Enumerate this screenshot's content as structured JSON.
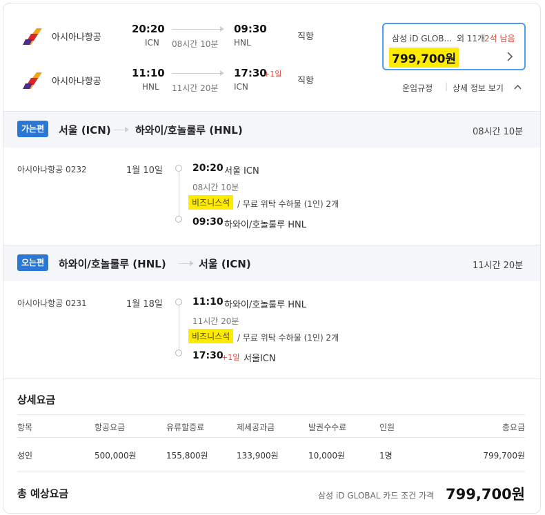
{
  "summary": {
    "outbound": {
      "airline": "아시아나항공",
      "dep_time": "20:20",
      "dep_code": "ICN",
      "duration": "08시간 10분",
      "arr_time": "09:30",
      "arr_code": "HNL",
      "arr_plus": "",
      "type": "직항"
    },
    "inbound": {
      "airline": "아시아나항공",
      "dep_time": "11:10",
      "dep_code": "HNL",
      "duration": "11시간 20분",
      "arr_time": "17:30",
      "arr_code": "ICN",
      "arr_plus": "+1일",
      "type": "직항"
    },
    "price_box": {
      "card_label": "삼성 iD GLOB...",
      "seats_prefix": "외 11개",
      "seats_left": "2석 남음",
      "price": "799,700원"
    },
    "fare_rules_link": "운임규정",
    "separator": "|",
    "details_link": "상세 정보 보기",
    "colors": {
      "accent_blue": "#2b77d6",
      "highlight": "#ffeb00",
      "red": "#e2483a",
      "box_border": "#4a9cf5"
    }
  },
  "outbound_section": {
    "badge": "가는편",
    "from": "서울 (ICN)",
    "to": "하와이/호놀룰루 (HNL)",
    "duration": "08시간 10분",
    "flight": "아시아나항공 0232",
    "date": "1월 10일",
    "dep_time": "20:20",
    "dep_place": "서울 ICN",
    "seg_duration": "08시간 10분",
    "cabin": "비즈니스석",
    "baggage": " / 무료 위탁 수하물 (1인) 2개",
    "arr_time": "09:30",
    "arr_plus": "",
    "arr_place": "하와이/호놀룰루 HNL"
  },
  "inbound_section": {
    "badge": "오는편",
    "from": "하와이/호놀룰루 (HNL)",
    "to": "서울 (ICN)",
    "duration": "11시간 20분",
    "flight": "아시아나항공 0231",
    "date": "1월 18일",
    "dep_time": "11:10",
    "dep_place": "하와이/호놀룰루 HNL",
    "seg_duration": "11시간 20분",
    "cabin": "비즈니스석",
    "baggage": " / 무료 위탁 수하물 (1인) 2개",
    "arr_time": "17:30",
    "arr_plus": "+1일",
    "arr_place": "서울ICN"
  },
  "fare_details": {
    "title": "상세요금",
    "headers": [
      "항목",
      "항공요금",
      "유류할증료",
      "제세공과금",
      "발권수수료",
      "인원",
      "총요금"
    ],
    "rows": [
      [
        "성인",
        "500,000원",
        "155,800원",
        "133,900원",
        "10,000원",
        "1명",
        "799,700원"
      ]
    ]
  },
  "total": {
    "label": "총 예상요금",
    "condition": "삼성 iD GLOBAL 카드 조건 가격",
    "price": "799,700원"
  }
}
